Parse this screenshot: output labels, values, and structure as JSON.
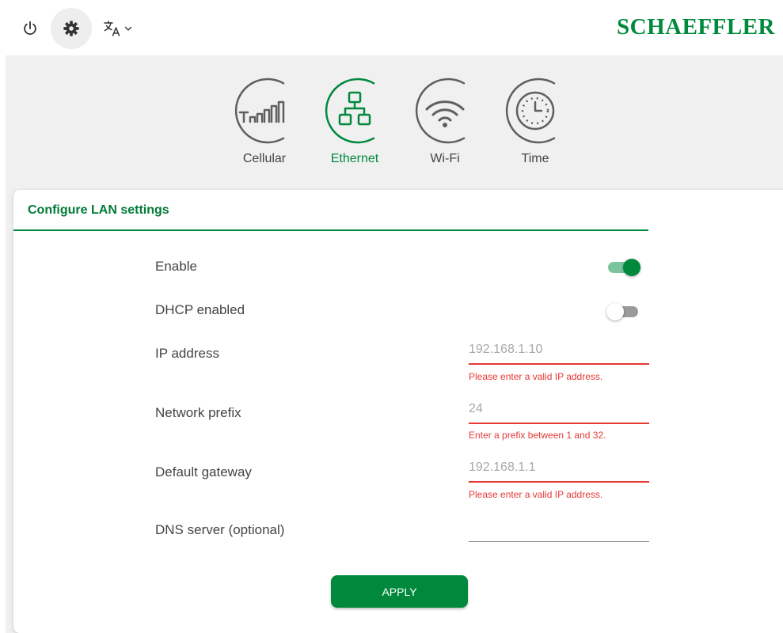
{
  "header": {
    "brand": "SCHAEFFLER",
    "icons": {
      "power": "power-icon",
      "settings": "gear-icon",
      "language": "translate-icon",
      "language_menu": "chevron-down-icon"
    }
  },
  "tabs": [
    {
      "label": "Cellular",
      "icon": "cellular-signal-icon",
      "active": false
    },
    {
      "label": "Ethernet",
      "icon": "ethernet-network-icon",
      "active": true
    },
    {
      "label": "Wi-Fi",
      "icon": "wifi-icon",
      "active": false
    },
    {
      "label": "Time",
      "icon": "clock-icon",
      "active": false
    }
  ],
  "form": {
    "title": "Configure LAN settings",
    "enable": {
      "label": "Enable",
      "on": true
    },
    "dhcp": {
      "label": "DHCP enabled",
      "on": false
    },
    "ip": {
      "label": "IP address",
      "value": "",
      "placeholder": "192.168.1.10",
      "error": "Please enter a valid IP address."
    },
    "prefix": {
      "label": "Network prefix",
      "value": "",
      "placeholder": "24",
      "error": "Enter a prefix between 1 and 32."
    },
    "gateway": {
      "label": "Default gateway",
      "value": "",
      "placeholder": "192.168.1.1",
      "error": "Please enter a valid IP address."
    },
    "dns": {
      "label": "DNS server (optional)",
      "value": "",
      "placeholder": ""
    },
    "apply_label": "APPLY"
  },
  "colors": {
    "brand": "#00893d",
    "error": "#e53935",
    "inactive_icon": "#5f5f5f",
    "band": "#f0f0f0"
  }
}
